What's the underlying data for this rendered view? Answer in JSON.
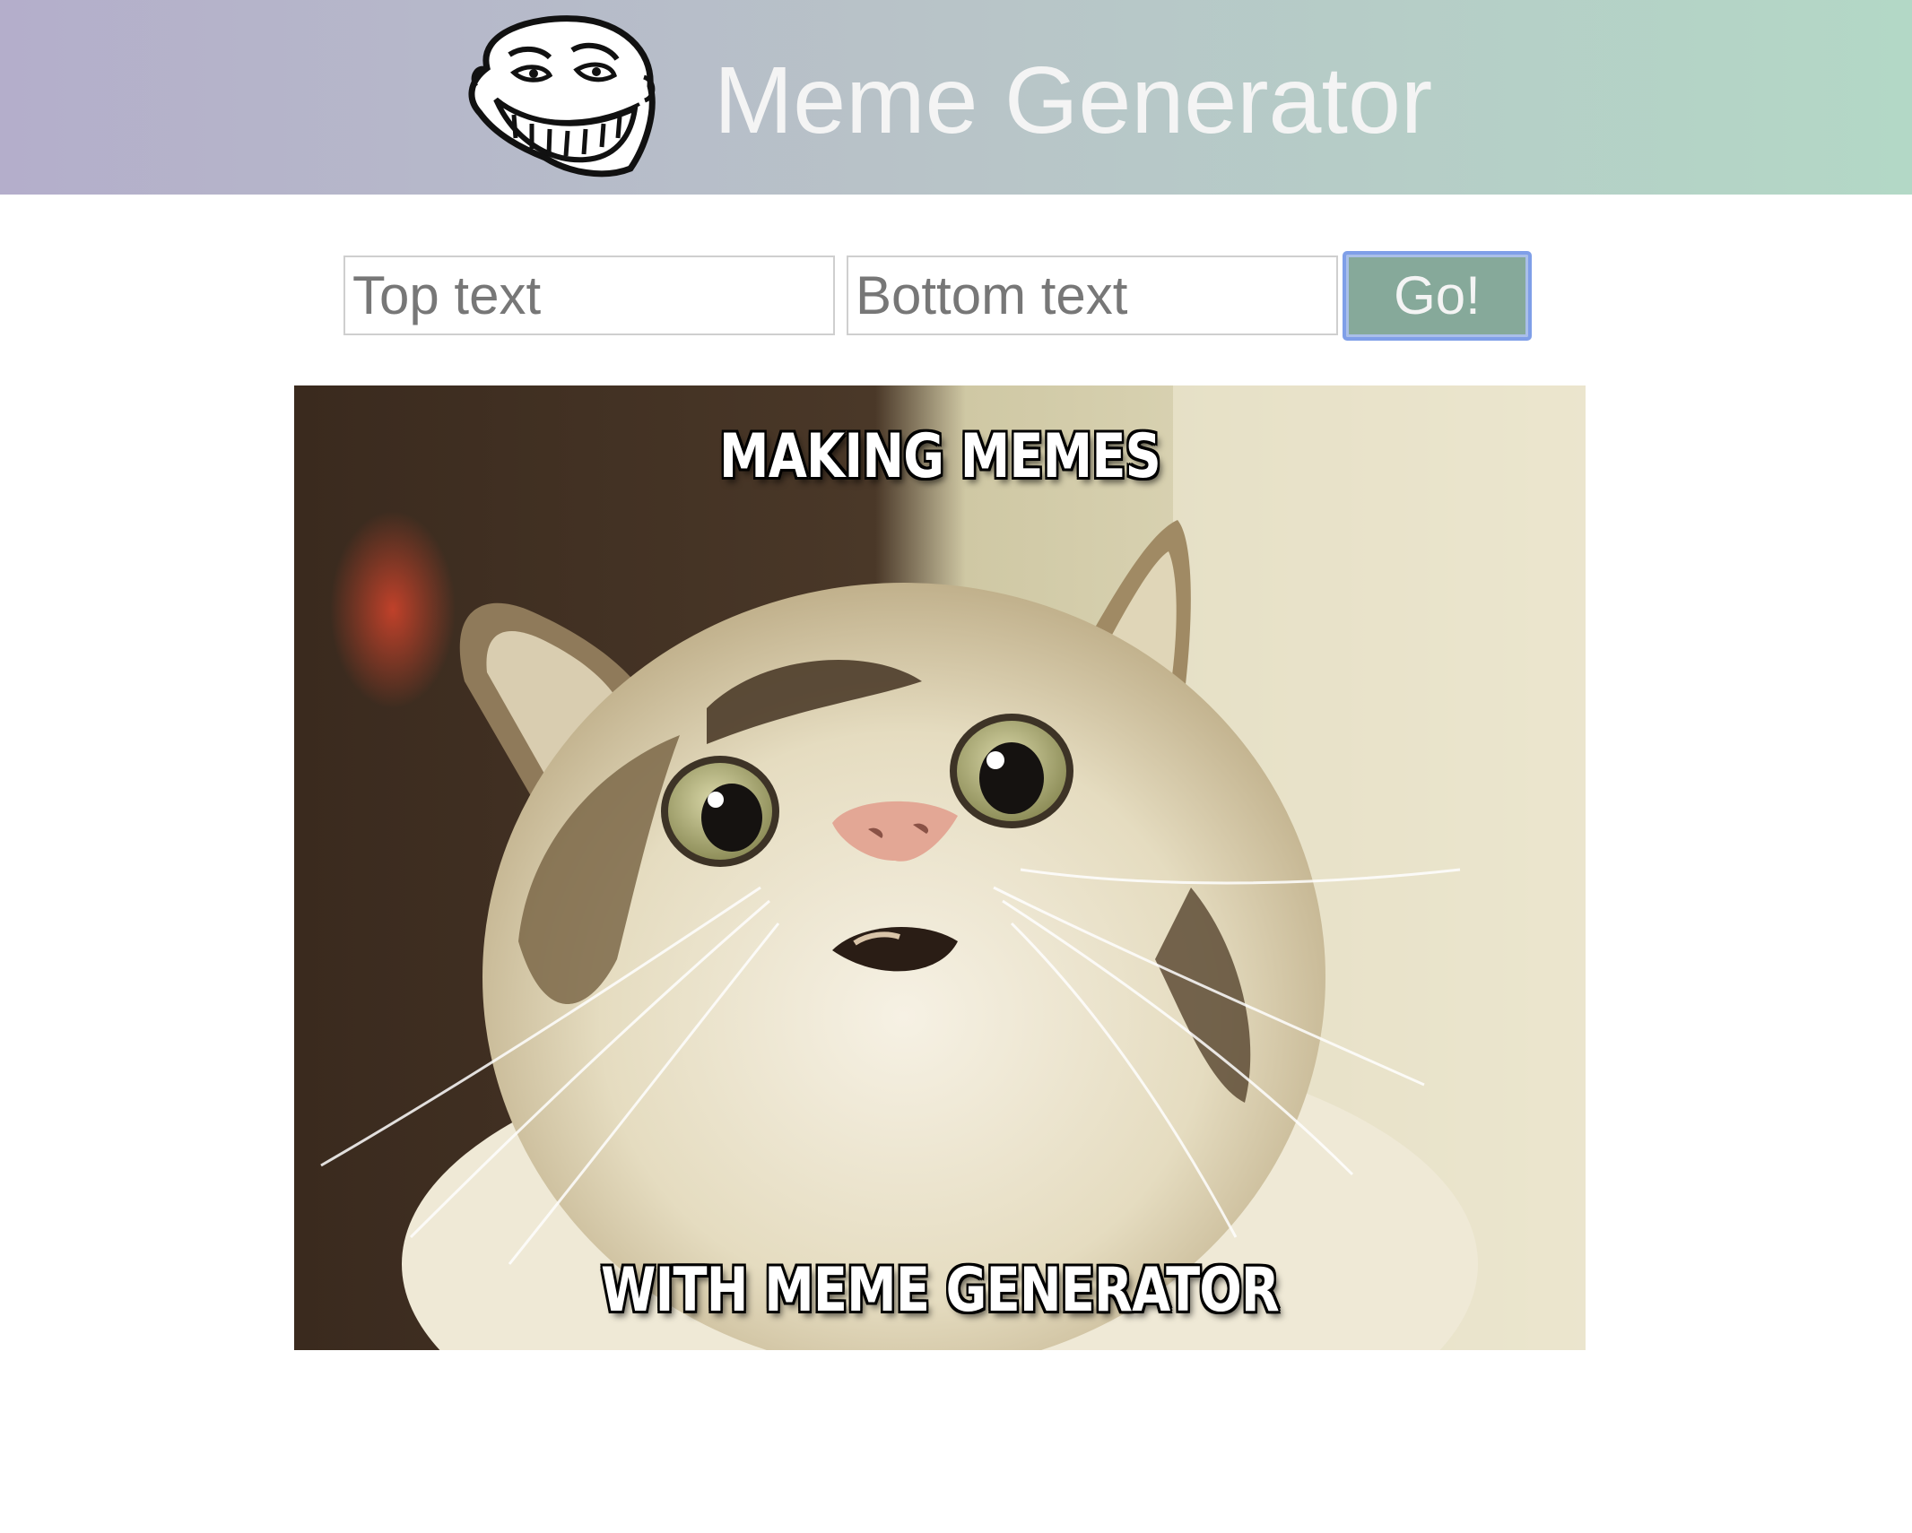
{
  "header": {
    "title": "Meme Generator",
    "logo_icon": "troll-face-icon"
  },
  "form": {
    "top_placeholder": "Top text",
    "bottom_placeholder": "Bottom text",
    "submit_label": "Go!"
  },
  "meme": {
    "image_subject": "surprised-cat-image",
    "top_text": "MAKING MEMES",
    "bottom_text": "WITH MEME GENERATOR"
  },
  "colors": {
    "header_gradient_left": "#b4aecb",
    "header_gradient_right": "#b3d8c6",
    "button_bg": "#86a99a",
    "button_focus_ring": "#7f9fe8"
  }
}
